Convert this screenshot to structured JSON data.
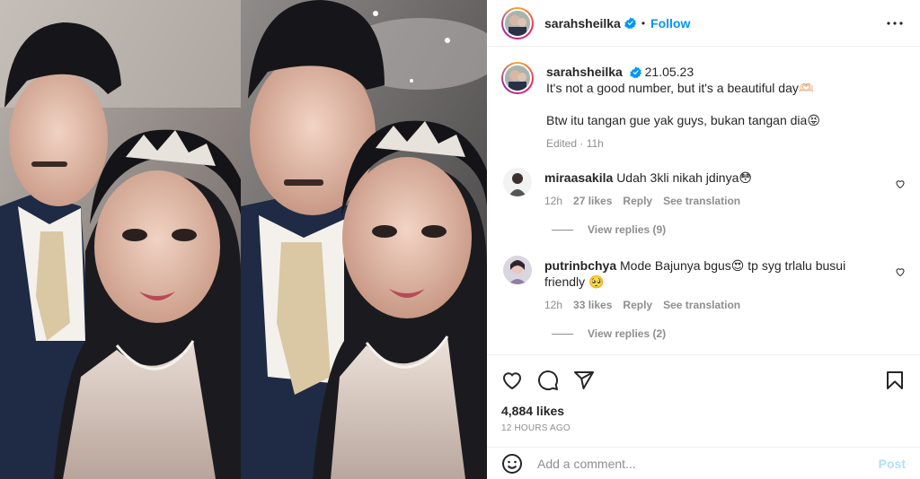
{
  "post": {
    "username": "sarahsheilka",
    "dot": "•",
    "follow_label": "Follow",
    "caption": {
      "username": "sarahsheilka",
      "date": "21.05.23",
      "line1": "It's not a good number, but it's a beautiful day🫶🏻",
      "line2": "Btw itu tangan gue yak guys, bukan tangan dia😝",
      "edited": "Edited · 11h"
    },
    "comments": [
      {
        "username": "miraasakila",
        "text": "Udah 3kli nikah jdinya😳",
        "time": "12h",
        "likes": "27 likes",
        "reply_label": "Reply",
        "translate_label": "See translation",
        "replies_label": "View replies (9)"
      },
      {
        "username": "putrinbchya",
        "text": "Mode Bajunya bgus😍 tp syg trlalu busui friendly 🥺",
        "time": "12h",
        "likes": "33 likes",
        "reply_label": "Reply",
        "translate_label": "See translation",
        "replies_label": "View replies (2)"
      }
    ],
    "likes_count": "4,884 likes",
    "time_ago": "12 HOURS AGO",
    "add_comment_placeholder": "Add a comment...",
    "post_label": "Post"
  },
  "icons": {
    "verified": "verified-badge-icon",
    "more": "more-options-icon",
    "heart": "heart-icon",
    "comment": "comment-icon",
    "share": "share-icon",
    "bookmark": "bookmark-icon",
    "emoji": "emoji-icon"
  },
  "colors": {
    "accent": "#0095f6",
    "post_disabled": "#b2dffc",
    "muted": "#8e8e8e",
    "text": "#262626"
  }
}
